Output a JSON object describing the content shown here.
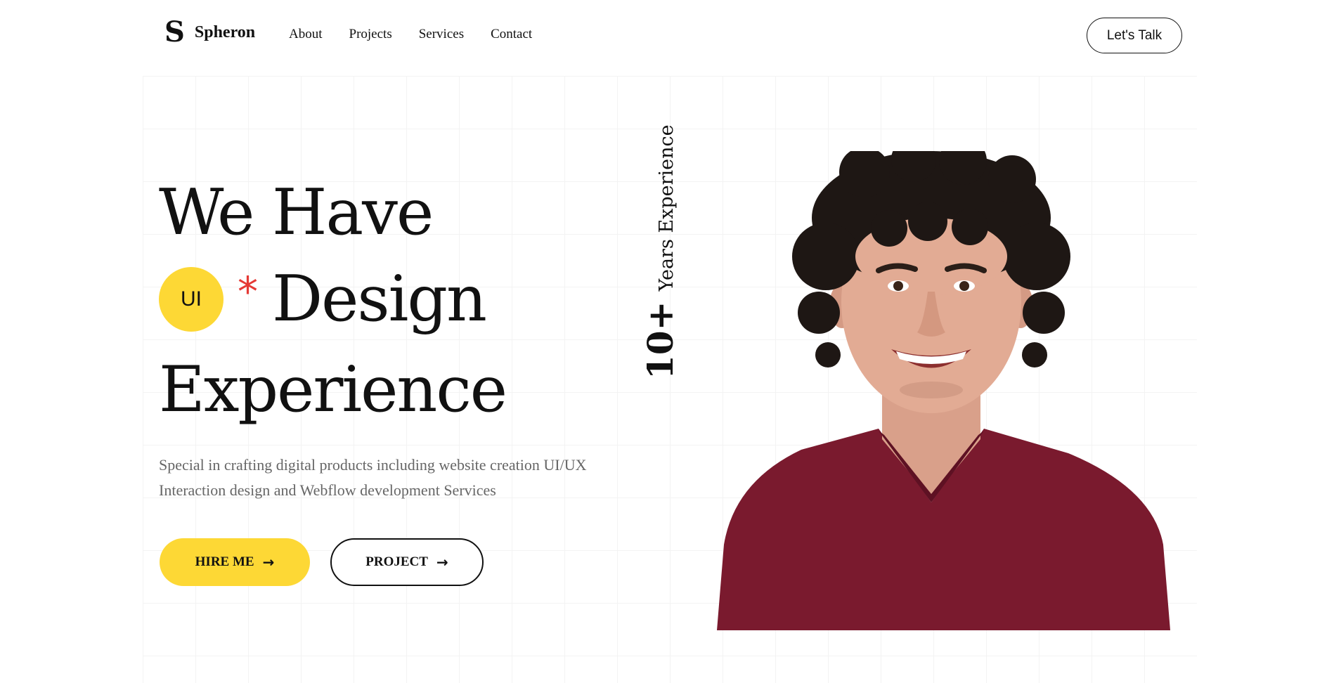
{
  "brand": {
    "logo_glyph": "S",
    "name": "Spheron"
  },
  "nav": {
    "items": [
      "About",
      "Projects",
      "Services",
      "Contact"
    ]
  },
  "header": {
    "cta_label": "Let's Talk"
  },
  "hero": {
    "line1": "We Have",
    "badge": "UI",
    "asterisk": "*",
    "line2_word": "Design",
    "line3": "Experience",
    "subtitle": "Special in crafting digital products including website creation UI/UX Interaction design and Webflow development Services",
    "primary_button": "HIRE ME",
    "secondary_button": "PROJECT",
    "arrow": "→",
    "experience_number": "10+",
    "experience_label": "Years Experience"
  },
  "colors": {
    "accent": "#fdd835",
    "asterisk": "#e53935",
    "shirt": "#7a1a2e",
    "text": "#111111",
    "muted": "#666666"
  }
}
